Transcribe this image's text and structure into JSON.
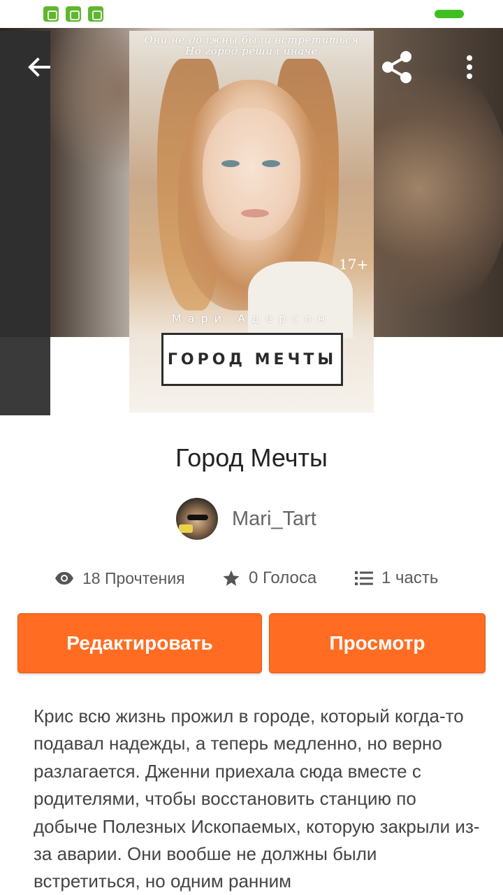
{
  "story": {
    "title": "Город Мечты",
    "author": "Mari_Tart",
    "cover": {
      "tagline_line1": "Они не должны были встретиться",
      "tagline_line2": "Но город решил иначе",
      "age_rating": "17+",
      "author_on_cover": "Мари Адерсон",
      "title_on_cover": "ГОРОД МЕЧТЫ"
    },
    "stats": {
      "reads": "18 Прочтения",
      "votes": "0 Голоса",
      "parts": "1 часть"
    },
    "description": "Крис всю жизнь прожил в городе, который когда-то подавал надежды, а теперь медленно, но верно разлагается. Дженни приехала сюда вместе с родителями, чтобы восстановить станцию по добыче Полезных Ископаемых, которую закрыли из-за аварии. Они вообше не должны были встретиться, но одним ранним"
  },
  "actions": {
    "edit_label": "Редактировать",
    "view_label": "Просмотр"
  },
  "icons": {
    "back": "arrow-left-icon",
    "share": "share-icon",
    "more": "more-vertical-icon",
    "reads": "eye-icon",
    "votes": "star-icon",
    "parts": "list-icon"
  },
  "colors": {
    "accent": "#ff6c22",
    "status_battery": "#3fbf1f",
    "notification": "#5fb72f"
  }
}
